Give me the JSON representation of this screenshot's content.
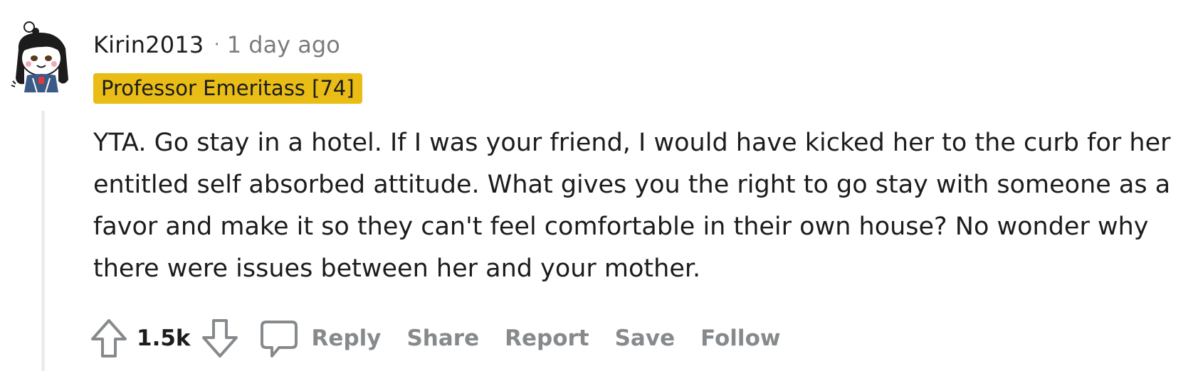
{
  "comment": {
    "username": "Kirin2013",
    "separator": "·",
    "timestamp": "1 day ago",
    "flair": "Professor Emeritass [74]",
    "body": "YTA. Go stay in a hotel. If I was your friend, I would have kicked her to the curb for her entitled self absorbed attitude. What gives you the right to go stay with someone as a favor and make it so they can't feel comfortable in their own house? No wonder why there were issues between her and your mother.",
    "score": "1.5k",
    "actions": {
      "reply": "Reply",
      "share": "Share",
      "report": "Report",
      "save": "Save",
      "follow": "Follow"
    },
    "icons": {
      "upvote": "upvote-arrow-icon",
      "downvote": "downvote-arrow-icon",
      "comment": "comment-bubble-icon",
      "avatar": "snoo-avatar"
    },
    "colors": {
      "flair_bg": "#e9bd15",
      "muted": "#878a8c",
      "text": "#1c1c1c",
      "thread_line": "#ececec"
    }
  }
}
